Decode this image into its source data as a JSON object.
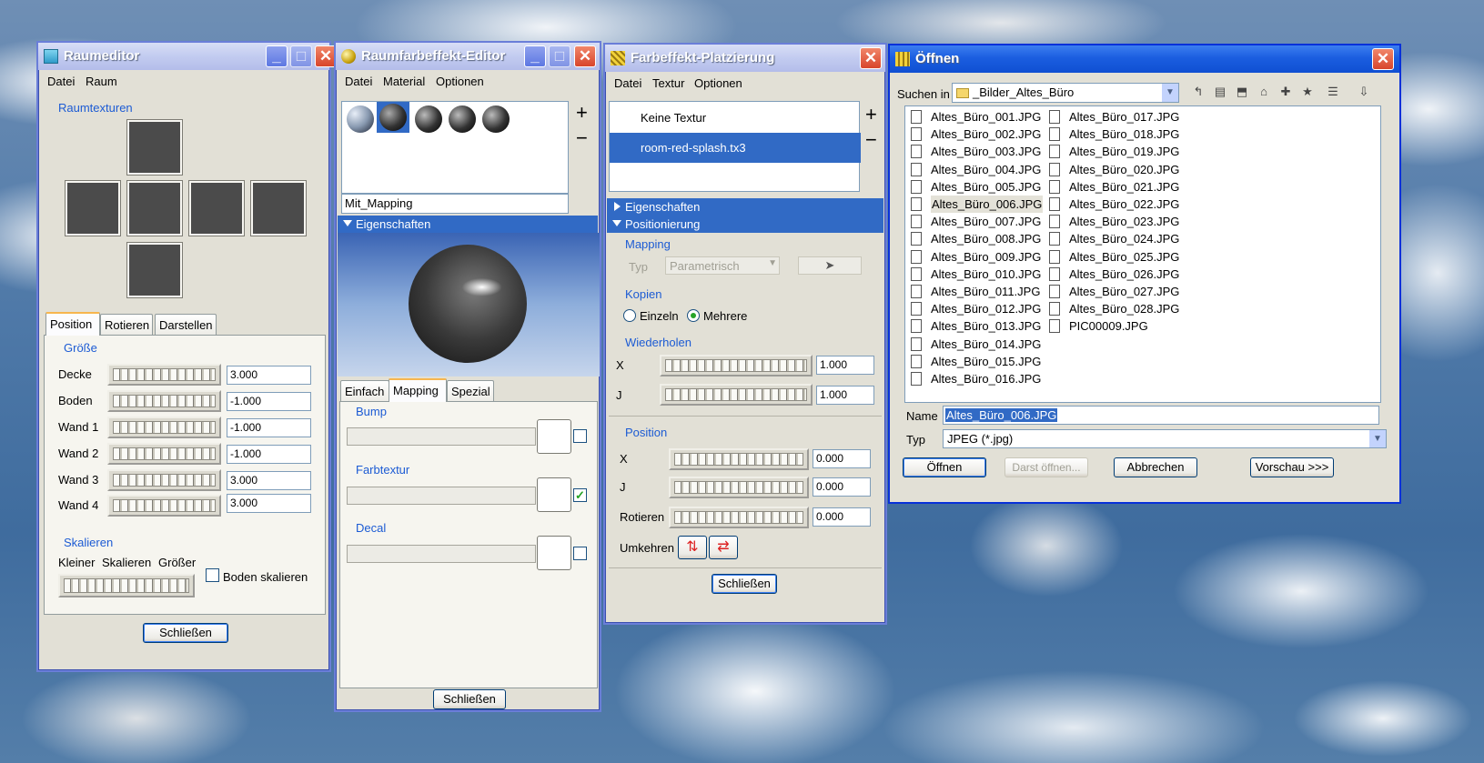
{
  "win1": {
    "title": "Raumeditor",
    "menu": [
      "Datei",
      "Raum"
    ],
    "group_textures": "Raumtexturen",
    "tabs": [
      "Position",
      "Rotieren",
      "Darstellen"
    ],
    "group_size": "Größe",
    "rows": [
      {
        "label": "Decke",
        "value": "3.000"
      },
      {
        "label": "Boden",
        "value": "-1.000"
      },
      {
        "label": "Wand 1",
        "value": "-1.000"
      },
      {
        "label": "Wand 2",
        "value": "-1.000"
      },
      {
        "label": "Wand 3",
        "value": "3.000"
      },
      {
        "label": "Wand 4",
        "value": "3.000"
      }
    ],
    "group_scale": "Skalieren",
    "scale_smaller": "Kleiner",
    "scale_label": "Skalieren",
    "scale_larger": "Größer",
    "floor_scale": "Boden skalieren",
    "close": "Schließen"
  },
  "win2": {
    "title": "Raumfarbeffekt-Editor",
    "menu": [
      "Datei",
      "Material",
      "Optionen"
    ],
    "name_field": "Mit_Mapping",
    "section": "Eigenschaften",
    "tabs": [
      "Einfach",
      "Mapping",
      "Spezial"
    ],
    "bump": "Bump",
    "farbtextur": "Farbtextur",
    "decal": "Decal",
    "plus": "+",
    "minus": "−",
    "close": "Schließen"
  },
  "win3": {
    "title": "Farbeffekt-Platzierung",
    "menu": [
      "Datei",
      "Textur",
      "Optionen"
    ],
    "list": [
      "Keine Textur",
      "room-red-splash.tx3"
    ],
    "sec_props": "Eigenschaften",
    "sec_pos": "Positionierung",
    "mapping": "Mapping",
    "typ": "Typ",
    "typ_value": "Parametrisch",
    "kopien": "Kopien",
    "einzeln": "Einzeln",
    "mehrere": "Mehrere",
    "wiederholen": "Wiederholen",
    "rep_x": "X",
    "rep_x_val": "1.000",
    "rep_j": "J",
    "rep_j_val": "1.000",
    "position": "Position",
    "pos_x": "X",
    "pos_x_val": "0.000",
    "pos_j": "J",
    "pos_j_val": "0.000",
    "rotieren": "Rotieren",
    "rot_val": "0.000",
    "umkehren": "Umkehren",
    "plus": "+",
    "minus": "−",
    "close": "Schließen"
  },
  "win4": {
    "title": "Öffnen",
    "look_in_label": "Suchen in",
    "look_in_value": "_Bilder_Altes_Büro",
    "files_col1": [
      "Altes_Büro_001.JPG",
      "Altes_Büro_002.JPG",
      "Altes_Büro_003.JPG",
      "Altes_Büro_004.JPG",
      "Altes_Büro_005.JPG",
      "Altes_Büro_006.JPG",
      "Altes_Büro_007.JPG",
      "Altes_Büro_008.JPG",
      "Altes_Büro_009.JPG",
      "Altes_Büro_010.JPG",
      "Altes_Büro_011.JPG",
      "Altes_Büro_012.JPG",
      "Altes_Büro_013.JPG",
      "Altes_Büro_014.JPG",
      "Altes_Büro_015.JPG",
      "Altes_Büro_016.JPG"
    ],
    "files_col2": [
      "Altes_Büro_017.JPG",
      "Altes_Büro_018.JPG",
      "Altes_Büro_019.JPG",
      "Altes_Büro_020.JPG",
      "Altes_Büro_021.JPG",
      "Altes_Büro_022.JPG",
      "Altes_Büro_023.JPG",
      "Altes_Büro_024.JPG",
      "Altes_Büro_025.JPG",
      "Altes_Büro_026.JPG",
      "Altes_Büro_027.JPG",
      "Altes_Büro_028.JPG",
      "PIC00009.JPG"
    ],
    "name_label": "Name",
    "name_value": "Altes_Büro_006.JPG",
    "type_label": "Typ",
    "type_value": "JPEG (*.jpg)",
    "btn_open": "Öffnen",
    "btn_open_readonly": "Darst öffnen...",
    "btn_cancel": "Abbrechen",
    "btn_preview": "Vorschau >>>"
  }
}
